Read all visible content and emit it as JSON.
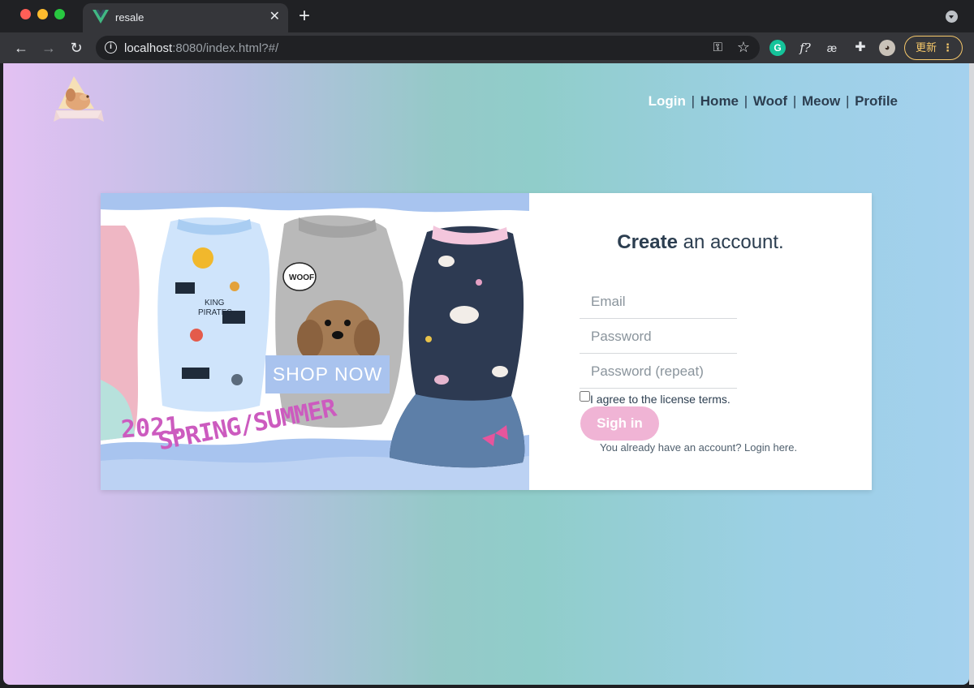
{
  "browser": {
    "tab": {
      "title": "resale"
    },
    "url": {
      "host": "localhost",
      "rest": ":8080/index.html?#/"
    },
    "update_label": "更新"
  },
  "site": {
    "nav": [
      {
        "label": "Login",
        "active": true
      },
      {
        "label": "Home",
        "active": false
      },
      {
        "label": "Woof",
        "active": false
      },
      {
        "label": "Meow",
        "active": false
      },
      {
        "label": "Profile",
        "active": false
      }
    ],
    "separator": "|"
  },
  "banner": {
    "shop_now": "SHOP NOW",
    "year": "2021",
    "season": "SPRING/SUMMER",
    "patch_text": "WOOF"
  },
  "form": {
    "title_bold": "Create",
    "title_rest": " an account.",
    "email_placeholder": "Email",
    "password_placeholder": "Password",
    "password_repeat_placeholder": "Password (repeat)",
    "terms_label": "I agree to the license terms.",
    "submit_label": "Sigh in",
    "login_hint": "You already have an account? Login here."
  },
  "colors": {
    "nav_text": "#2c3e50",
    "nav_active": "#ffffff",
    "button_pink": "#f0b4d5",
    "banner_pink_text": "#cc5bbf",
    "shop_now_bg": "#a9c3ee"
  }
}
